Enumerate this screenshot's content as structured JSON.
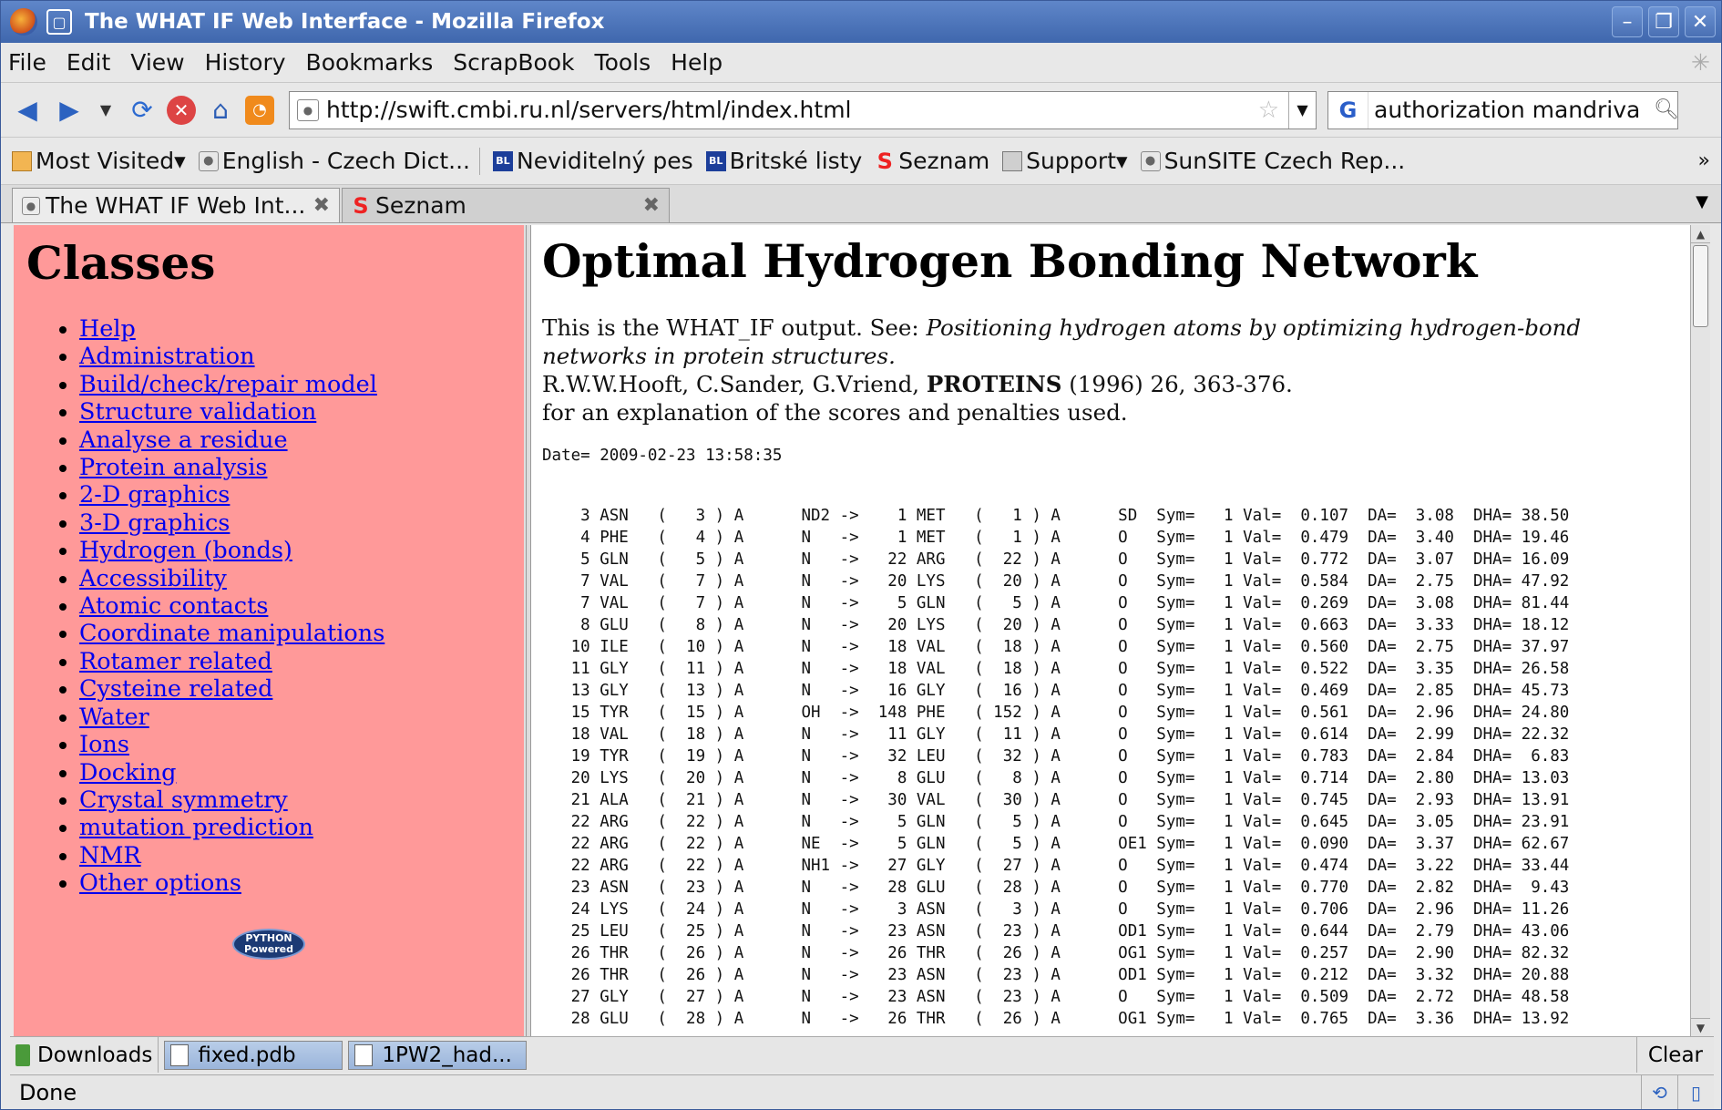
{
  "window": {
    "title": "The WHAT IF Web Interface - Mozilla Firefox"
  },
  "menu": [
    "File",
    "Edit",
    "View",
    "History",
    "Bookmarks",
    "ScrapBook",
    "Tools",
    "Help"
  ],
  "nav": {
    "url": "http://swift.cmbi.ru.nl/servers/html/index.html",
    "search_value": "authorization mandriva",
    "search_engine_icon": "G"
  },
  "bookmarks": [
    "Most Visited",
    "English - Czech Dict...",
    "Neviditelný pes",
    "Britské listy",
    "Seznam",
    "Support",
    "SunSITE Czech Rep..."
  ],
  "bookmark_icons": {
    "bl": "BL",
    "s": "S"
  },
  "tabs": [
    {
      "label": "The WHAT IF Web Int..."
    },
    {
      "label": "Seznam"
    }
  ],
  "sidebar": {
    "title": "Classes",
    "links": [
      "Help",
      "Administration",
      "Build/check/repair model",
      "Structure validation",
      "Analyse a residue",
      "Protein analysis",
      "2-D graphics",
      "3-D graphics",
      "Hydrogen (bonds)",
      "Accessibility",
      "Atomic contacts",
      "Coordinate manipulations",
      "Rotamer related",
      "Cysteine related",
      "Water",
      "Ions",
      "Docking",
      "Crystal symmetry",
      "mutation prediction",
      "NMR",
      "Other options"
    ],
    "python_badge": [
      "PYTHON",
      "Powered"
    ]
  },
  "main": {
    "title": "Optimal Hydrogen Bonding Network",
    "intro_prefix": "This is the WHAT_IF output. See: ",
    "intro_italic": "Positioning hydrogen atoms by optimizing hydrogen-bond networks in protein structures.",
    "authors": "R.W.W.Hooft, C.Sander, G.Vriend, ",
    "journal": "PROTEINS",
    "citation": " (1996) 26, 363-376.",
    "explanation": "for an explanation of the scores and penalties used.",
    "date": "Date= 2009-02-23 13:58:35",
    "rows": [
      "    3 ASN   (   3 ) A      ND2 ->    1 MET   (   1 ) A      SD  Sym=   1 Val=  0.107  DA=  3.08  DHA= 38.50",
      "    4 PHE   (   4 ) A      N   ->    1 MET   (   1 ) A      O   Sym=   1 Val=  0.479  DA=  3.40  DHA= 19.46",
      "    5 GLN   (   5 ) A      N   ->   22 ARG   (  22 ) A      O   Sym=   1 Val=  0.772  DA=  3.07  DHA= 16.09",
      "    7 VAL   (   7 ) A      N   ->   20 LYS   (  20 ) A      O   Sym=   1 Val=  0.584  DA=  2.75  DHA= 47.92",
      "    7 VAL   (   7 ) A      N   ->    5 GLN   (   5 ) A      O   Sym=   1 Val=  0.269  DA=  3.08  DHA= 81.44",
      "    8 GLU   (   8 ) A      N   ->   20 LYS   (  20 ) A      O   Sym=   1 Val=  0.663  DA=  3.33  DHA= 18.12",
      "   10 ILE   (  10 ) A      N   ->   18 VAL   (  18 ) A      O   Sym=   1 Val=  0.560  DA=  2.75  DHA= 37.97",
      "   11 GLY   (  11 ) A      N   ->   18 VAL   (  18 ) A      O   Sym=   1 Val=  0.522  DA=  3.35  DHA= 26.58",
      "   13 GLY   (  13 ) A      N   ->   16 GLY   (  16 ) A      O   Sym=   1 Val=  0.469  DA=  2.85  DHA= 45.73",
      "   15 TYR   (  15 ) A      OH  ->  148 PHE   ( 152 ) A      O   Sym=   1 Val=  0.561  DA=  2.96  DHA= 24.80",
      "   18 VAL   (  18 ) A      N   ->   11 GLY   (  11 ) A      O   Sym=   1 Val=  0.614  DA=  2.99  DHA= 22.32",
      "   19 TYR   (  19 ) A      N   ->   32 LEU   (  32 ) A      O   Sym=   1 Val=  0.783  DA=  2.84  DHA=  6.83",
      "   20 LYS   (  20 ) A      N   ->    8 GLU   (   8 ) A      O   Sym=   1 Val=  0.714  DA=  2.80  DHA= 13.03",
      "   21 ALA   (  21 ) A      N   ->   30 VAL   (  30 ) A      O   Sym=   1 Val=  0.745  DA=  2.93  DHA= 13.91",
      "   22 ARG   (  22 ) A      N   ->    5 GLN   (   5 ) A      O   Sym=   1 Val=  0.645  DA=  3.05  DHA= 23.91",
      "   22 ARG   (  22 ) A      NE  ->    5 GLN   (   5 ) A      OE1 Sym=   1 Val=  0.090  DA=  3.37  DHA= 62.67",
      "   22 ARG   (  22 ) A      NH1 ->   27 GLY   (  27 ) A      O   Sym=   1 Val=  0.474  DA=  3.22  DHA= 33.44",
      "   23 ASN   (  23 ) A      N   ->   28 GLU   (  28 ) A      O   Sym=   1 Val=  0.770  DA=  2.82  DHA=  9.43",
      "   24 LYS   (  24 ) A      N   ->    3 ASN   (   3 ) A      O   Sym=   1 Val=  0.706  DA=  2.96  DHA= 11.26",
      "   25 LEU   (  25 ) A      N   ->   23 ASN   (  23 ) A      OD1 Sym=   1 Val=  0.644  DA=  2.79  DHA= 43.06",
      "   26 THR   (  26 ) A      N   ->   26 THR   (  26 ) A      OG1 Sym=   1 Val=  0.257  DA=  2.90  DHA= 82.32",
      "   26 THR   (  26 ) A      N   ->   23 ASN   (  23 ) A      OD1 Sym=   1 Val=  0.212  DA=  3.32  DHA= 20.88",
      "   27 GLY   (  27 ) A      N   ->   23 ASN   (  23 ) A      O   Sym=   1 Val=  0.509  DA=  2.72  DHA= 48.58",
      "   28 GLU   (  28 ) A      N   ->   26 THR   (  26 ) A      OG1 Sym=   1 Val=  0.765  DA=  3.36  DHA= 13.92"
    ]
  },
  "downloads": {
    "label": "Downloads",
    "items": [
      "fixed.pdb",
      "1PW2_had..."
    ],
    "clear": "Clear"
  },
  "status": {
    "text": "Done"
  }
}
